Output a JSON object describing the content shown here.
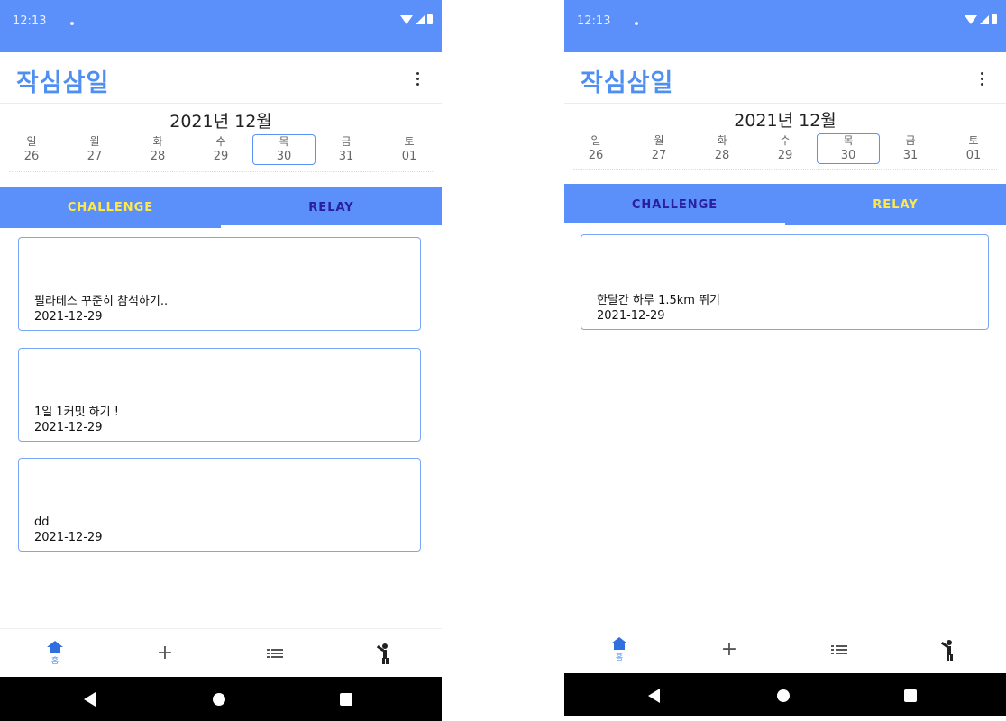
{
  "screens": [
    {
      "status_time": "12:13",
      "app_title": "작심삼일",
      "month_title": "2021년 12월",
      "days": [
        {
          "name": "일",
          "date": "26"
        },
        {
          "name": "월",
          "date": "27"
        },
        {
          "name": "화",
          "date": "28"
        },
        {
          "name": "수",
          "date": "29"
        },
        {
          "name": "목",
          "date": "30"
        },
        {
          "name": "금",
          "date": "31"
        },
        {
          "name": "토",
          "date": "01"
        }
      ],
      "selected_day_index": 4,
      "tabs": [
        "CHALLENGE",
        "RELAY"
      ],
      "active_tab_index": 0,
      "cards": [
        {
          "title": "필라테스 꾸준히 참석하기..",
          "date": "2021-12-29"
        },
        {
          "title": "1일 1커밋 하기 !",
          "date": "2021-12-29"
        },
        {
          "title": "dd",
          "date": "2021-12-29"
        }
      ],
      "nav": {
        "home_label": "홈"
      }
    },
    {
      "status_time": "12:13",
      "app_title": "작심삼일",
      "month_title": "2021년 12월",
      "days": [
        {
          "name": "일",
          "date": "26"
        },
        {
          "name": "월",
          "date": "27"
        },
        {
          "name": "화",
          "date": "28"
        },
        {
          "name": "수",
          "date": "29"
        },
        {
          "name": "목",
          "date": "30"
        },
        {
          "name": "금",
          "date": "31"
        },
        {
          "name": "토",
          "date": "01"
        }
      ],
      "selected_day_index": 4,
      "tabs": [
        "CHALLENGE",
        "RELAY"
      ],
      "active_tab_index": 1,
      "cards": [
        {
          "title": "한달간 하루 1.5km 뛰기",
          "date": "2021-12-29"
        }
      ],
      "nav": {
        "home_label": "홈"
      }
    }
  ],
  "colors": {
    "primary": "#5b8ff9",
    "title_blue": "#4f8ff2",
    "active_tab_text": "#ffe94a",
    "inactive_tab_text": "#2a1f9e",
    "card_border": "#7aa7f5"
  },
  "icons": {
    "nav": [
      "home-icon",
      "plus-icon",
      "list-icon",
      "person-icon"
    ],
    "system": [
      "back-icon",
      "home-circle-icon",
      "recents-icon"
    ]
  }
}
